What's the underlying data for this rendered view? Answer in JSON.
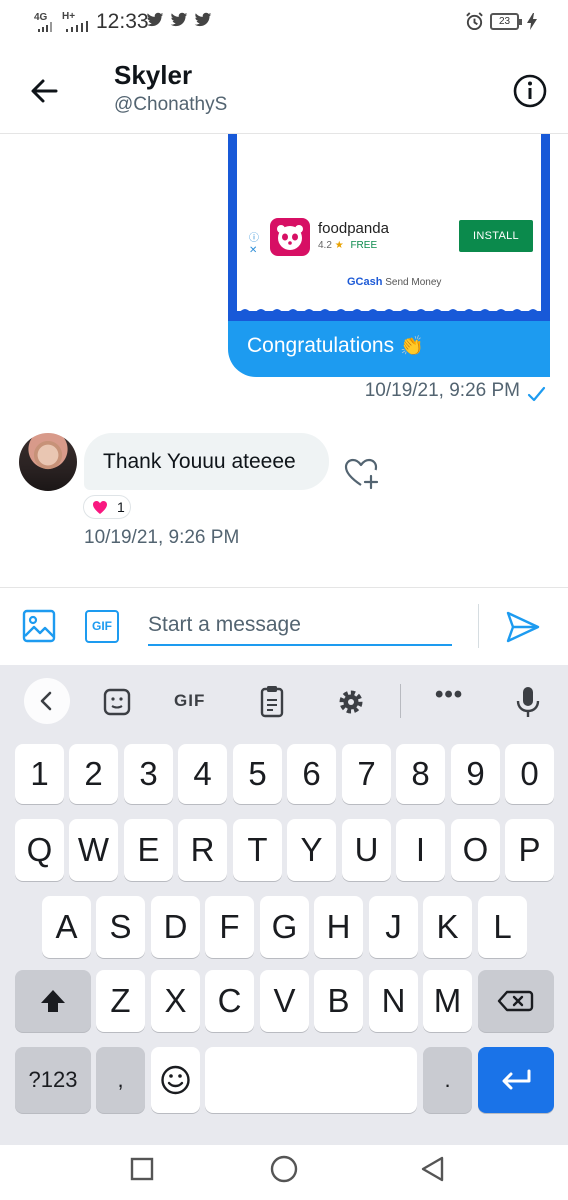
{
  "status_bar": {
    "network_1": "4G",
    "network_2": "H+",
    "time": "12:33",
    "battery": "23",
    "icons": [
      "twitter-bird-icon",
      "twitter-bird-icon",
      "twitter-bird-icon",
      "alarm-icon",
      "battery-icon",
      "charging-icon"
    ]
  },
  "header": {
    "name": "Skyler",
    "handle": "@ChonathyS",
    "back_icon": "arrow-left-icon",
    "info_icon": "info-icon"
  },
  "sent_message": {
    "ad": {
      "app_name": "foodpanda",
      "rating": "4.2",
      "price": "FREE",
      "install_label": "INSTALL",
      "sponsor_brand": "GCash",
      "sponsor_text": "Send Money"
    },
    "text": "Congratulations",
    "emoji": "👏",
    "timestamp": "10/19/21, 9:26 PM",
    "status_icon": "checkmark-icon"
  },
  "received_message": {
    "text": "Thank Youuu ateeee",
    "reaction_emoji": "heart",
    "reaction_count": "1",
    "timestamp": "10/19/21, 9:26 PM"
  },
  "composer": {
    "placeholder": "Start a message",
    "gif_label": "GIF"
  },
  "keyboard": {
    "gif_label": "GIF",
    "rows": [
      [
        "1",
        "2",
        "3",
        "4",
        "5",
        "6",
        "7",
        "8",
        "9",
        "0"
      ],
      [
        "Q",
        "W",
        "E",
        "R",
        "T",
        "Y",
        "U",
        "I",
        "O",
        "P"
      ],
      [
        "A",
        "S",
        "D",
        "F",
        "G",
        "H",
        "J",
        "K",
        "L"
      ],
      [
        "Z",
        "X",
        "C",
        "V",
        "B",
        "N",
        "M"
      ]
    ],
    "symbols_label": "?123",
    "comma": ",",
    "period": "."
  },
  "colors": {
    "accent": "#1d9bf0",
    "card_frame": "#1859d8",
    "install_green": "#0b8a4c",
    "foodpanda_pink": "#d70f64",
    "heart_red": "#f91880",
    "keyboard_bg": "#e8e9ee",
    "enter_blue": "#1a73e8"
  }
}
